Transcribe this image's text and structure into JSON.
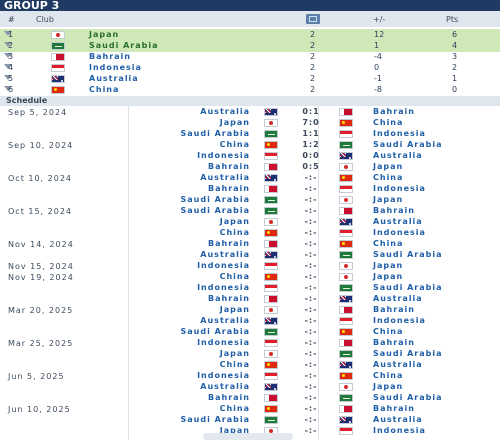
{
  "title": "GROUP 3",
  "table": {
    "headers": {
      "num": "#",
      "club": "Club",
      "diff": "+/-",
      "pts": "Pts"
    },
    "rows": [
      {
        "rank": "1",
        "team": "Japan",
        "flag": "jp",
        "mp": "2",
        "gd": "12",
        "pts": "6",
        "qualified": true
      },
      {
        "rank": "2",
        "team": "Saudi Arabia",
        "flag": "sa",
        "mp": "2",
        "gd": "1",
        "pts": "4",
        "qualified": true
      },
      {
        "rank": "3",
        "team": "Bahrain",
        "flag": "bh",
        "mp": "2",
        "gd": "-4",
        "pts": "3",
        "qualified": false
      },
      {
        "rank": "4",
        "team": "Indonesia",
        "flag": "id",
        "mp": "2",
        "gd": "0",
        "pts": "2",
        "qualified": false
      },
      {
        "rank": "5",
        "team": "Australia",
        "flag": "au",
        "mp": "2",
        "gd": "-1",
        "pts": "1",
        "qualified": false
      },
      {
        "rank": "6",
        "team": "China",
        "flag": "cn",
        "mp": "2",
        "gd": "-8",
        "pts": "0",
        "qualified": false
      }
    ]
  },
  "schedule": {
    "label": "Schedule",
    "matches": [
      {
        "date": "Sep 5, 2024",
        "home": "Australia",
        "hf": "au",
        "score": "0:1",
        "away": "Bahrain",
        "af": "bh"
      },
      {
        "date": "",
        "home": "Japan",
        "hf": "jp",
        "score": "7:0",
        "away": "China",
        "af": "cn"
      },
      {
        "date": "",
        "home": "Saudi Arabia",
        "hf": "sa",
        "score": "1:1",
        "away": "Indonesia",
        "af": "id"
      },
      {
        "date": "Sep 10, 2024",
        "home": "China",
        "hf": "cn",
        "score": "1:2",
        "away": "Saudi Arabia",
        "af": "sa"
      },
      {
        "date": "",
        "home": "Indonesia",
        "hf": "id",
        "score": "0:0",
        "away": "Australia",
        "af": "au"
      },
      {
        "date": "",
        "home": "Bahrain",
        "hf": "bh",
        "score": "0:5",
        "away": "Japan",
        "af": "jp"
      },
      {
        "date": "Oct 10, 2024",
        "home": "Australia",
        "hf": "au",
        "score": "-:-",
        "away": "China",
        "af": "cn"
      },
      {
        "date": "",
        "home": "Bahrain",
        "hf": "bh",
        "score": "-:-",
        "away": "Indonesia",
        "af": "id"
      },
      {
        "date": "",
        "home": "Saudi Arabia",
        "hf": "sa",
        "score": "-:-",
        "away": "Japan",
        "af": "jp"
      },
      {
        "date": "Oct 15, 2024",
        "home": "Saudi Arabia",
        "hf": "sa",
        "score": "-:-",
        "away": "Bahrain",
        "af": "bh"
      },
      {
        "date": "",
        "home": "Japan",
        "hf": "jp",
        "score": "-:-",
        "away": "Australia",
        "af": "au"
      },
      {
        "date": "",
        "home": "China",
        "hf": "cn",
        "score": "-:-",
        "away": "Indonesia",
        "af": "id"
      },
      {
        "date": "Nov 14, 2024",
        "home": "Bahrain",
        "hf": "bh",
        "score": "-:-",
        "away": "China",
        "af": "cn"
      },
      {
        "date": "",
        "home": "Australia",
        "hf": "au",
        "score": "-:-",
        "away": "Saudi Arabia",
        "af": "sa"
      },
      {
        "date": "Nov 15, 2024",
        "home": "Indonesia",
        "hf": "id",
        "score": "-:-",
        "away": "Japan",
        "af": "jp"
      },
      {
        "date": "Nov 19, 2024",
        "home": "China",
        "hf": "cn",
        "score": "-:-",
        "away": "Japan",
        "af": "jp"
      },
      {
        "date": "",
        "home": "Indonesia",
        "hf": "id",
        "score": "-:-",
        "away": "Saudi Arabia",
        "af": "sa"
      },
      {
        "date": "",
        "home": "Bahrain",
        "hf": "bh",
        "score": "-:-",
        "away": "Australia",
        "af": "au"
      },
      {
        "date": "Mar 20, 2025",
        "home": "Japan",
        "hf": "jp",
        "score": "-:-",
        "away": "Bahrain",
        "af": "bh"
      },
      {
        "date": "",
        "home": "Australia",
        "hf": "au",
        "score": "-:-",
        "away": "Indonesia",
        "af": "id"
      },
      {
        "date": "",
        "home": "Saudi Arabia",
        "hf": "sa",
        "score": "-:-",
        "away": "China",
        "af": "cn"
      },
      {
        "date": "Mar 25, 2025",
        "home": "Indonesia",
        "hf": "id",
        "score": "-:-",
        "away": "Bahrain",
        "af": "bh"
      },
      {
        "date": "",
        "home": "Japan",
        "hf": "jp",
        "score": "-:-",
        "away": "Saudi Arabia",
        "af": "sa"
      },
      {
        "date": "",
        "home": "China",
        "hf": "cn",
        "score": "-:-",
        "away": "Australia",
        "af": "au"
      },
      {
        "date": "Jun 5, 2025",
        "home": "Indonesia",
        "hf": "id",
        "score": "-:-",
        "away": "China",
        "af": "cn"
      },
      {
        "date": "",
        "home": "Australia",
        "hf": "au",
        "score": "-:-",
        "away": "Japan",
        "af": "jp"
      },
      {
        "date": "",
        "home": "Bahrain",
        "hf": "bh",
        "score": "-:-",
        "away": "Saudi Arabia",
        "af": "sa"
      },
      {
        "date": "Jun 10, 2025",
        "home": "China",
        "hf": "cn",
        "score": "-:-",
        "away": "Bahrain",
        "af": "bh"
      },
      {
        "date": "",
        "home": "Saudi Arabia",
        "hf": "sa",
        "score": "-:-",
        "away": "Australia",
        "af": "au"
      },
      {
        "date": "",
        "home": "Japan",
        "hf": "jp",
        "score": "-:-",
        "away": "Indonesia",
        "af": "id"
      }
    ]
  },
  "colors": {
    "header": "#1f3a63",
    "qualified": "#cfe8b8",
    "team_link": "#1f5fa8"
  },
  "icons": {
    "matches_played": "pitch-icon",
    "trend": "triangle-down-icon"
  }
}
